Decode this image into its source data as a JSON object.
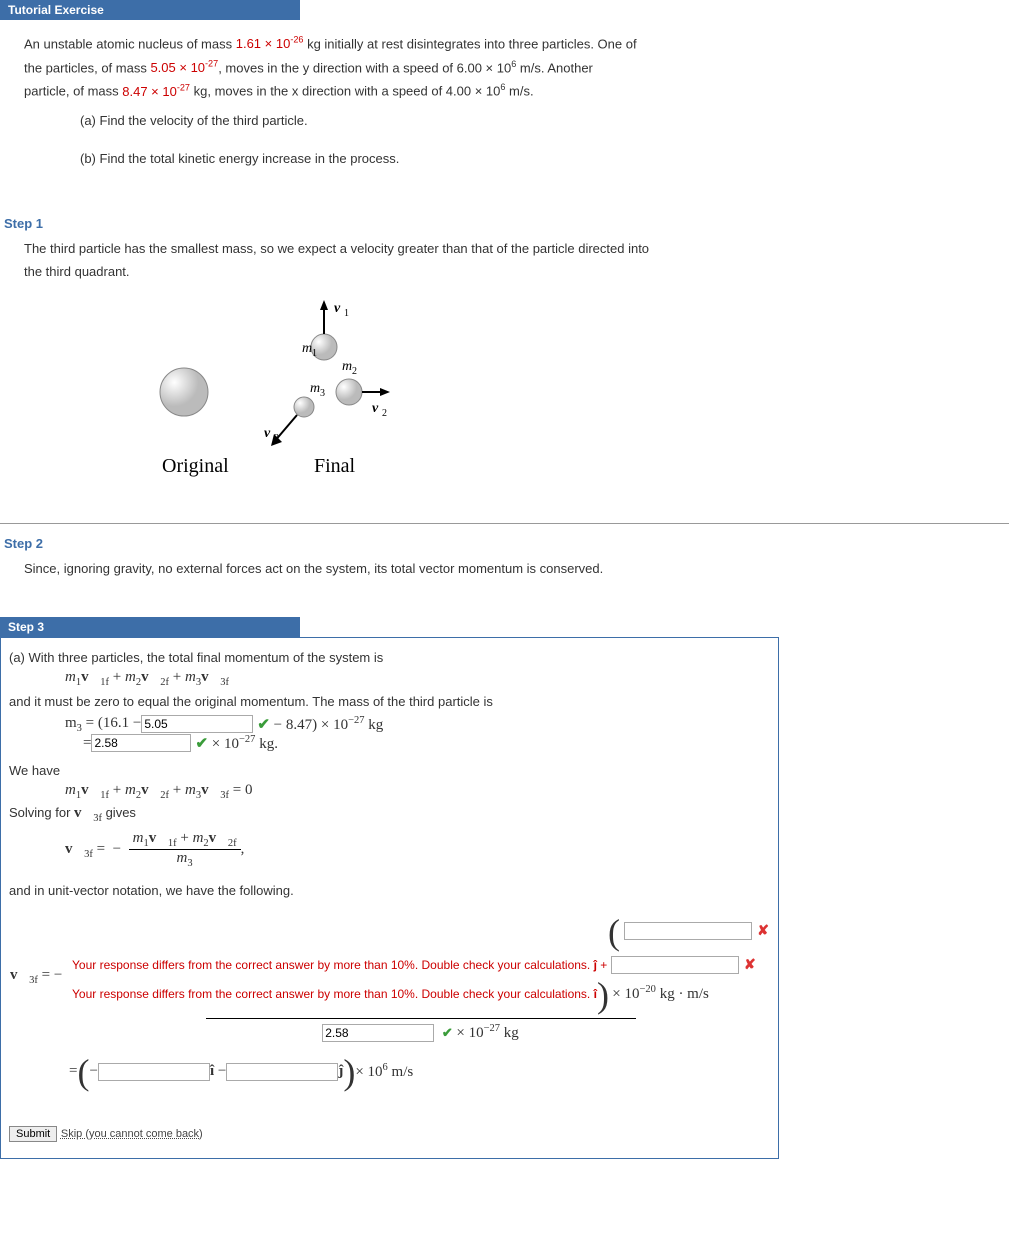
{
  "tutorial_header": "Tutorial Exercise",
  "problem": {
    "line1a": "An unstable atomic nucleus of mass ",
    "mass_total": "1.61 × 10",
    "mass_total_exp": "-26",
    "line1b": " kg initially at rest disintegrates into three particles. One of",
    "line2a": "the particles, of mass ",
    "mass1": "5.05 × 10",
    "mass1_exp": "-27",
    "line2b": ", moves in the y direction with a speed of 6.00 × 10",
    "speed1_exp": "6",
    "line2c": " m/s. Another",
    "line3a": "particle, of mass ",
    "mass2": "8.47 × 10",
    "mass2_exp": "-27",
    "line3b": " kg, moves in the x direction with a speed of 4.00 × 10",
    "speed2_exp": "6",
    "line3c": " m/s.",
    "part_a": "(a) Find the velocity of the third particle.",
    "part_b": "(b) Find the total kinetic energy increase in the process."
  },
  "step1": {
    "title": "Step 1",
    "text1": "The third particle has the smallest mass, so we expect a velocity greater than that of the particle directed into",
    "text2": "the third quadrant.",
    "label_original": "Original",
    "label_final": "Final",
    "m1": "m",
    "m1_sub": "1",
    "m2": "m",
    "m2_sub": "2",
    "m3": "m",
    "m3_sub": "3",
    "v1": "v",
    "v1_sub": "1",
    "v2": "v",
    "v2_sub": "2",
    "v3": "v",
    "v3_sub": "3"
  },
  "step2": {
    "title": "Step 2",
    "text": "Since, ignoring gravity, no external forces act on the system, its total vector momentum is conserved."
  },
  "step3": {
    "title": "Step 3",
    "text1": "(a) With three particles, the total final momentum of the system is",
    "text2": "and it must be zero to equal the original momentum. The mass of the third particle is",
    "m3_eq_prefix": "m₃ = (16.1 − ",
    "input1_val": "5.05",
    "m3_eq_suffix": " − 8.47) × 10",
    "m3_eq_exp": "−27",
    "m3_eq_kg": " kg",
    "m3_result_eq": "= ",
    "input2_val": "2.58",
    "m3_result_units": " × 10",
    "m3_result_exp": "−27",
    "m3_result_kg": " kg.",
    "we_have": "We have",
    "solving": "Solving for ",
    "gives": " gives",
    "unit_vector_text": "and in unit-vector notation, we have the following.",
    "feedback_text": "Your response differs from the correct answer by more than 10%. Double check your calculations.",
    "input3_val": "",
    "input4_val": "",
    "input5_val": "2.58",
    "input6_val": "",
    "input7_val": "",
    "final_units1a": " × 10",
    "final_exp1": "−20",
    "final_units1b": " kg · m/s",
    "final_units2a": " × 10",
    "final_exp2": "−27",
    "final_units2b": " kg",
    "final_units3a": " × 10",
    "final_exp3": "6",
    "final_units3b": " m/s",
    "jhat": " ĵ +",
    "ihat_close": " î",
    "ihat_minus": " î − ",
    "jhat_close": " ĵ"
  },
  "buttons": {
    "submit": "Submit",
    "skip": "Skip (you cannot come back)"
  }
}
